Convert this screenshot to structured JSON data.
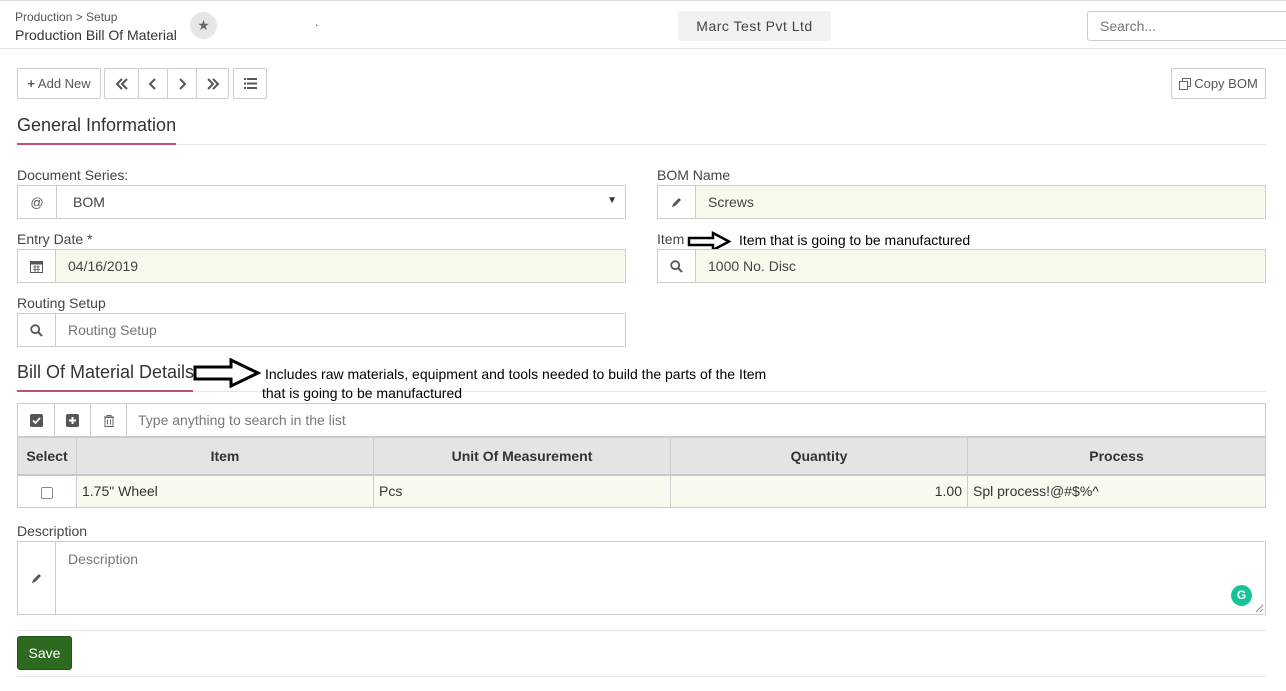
{
  "header": {
    "breadcrumb": "Production > Setup",
    "title": "Production Bill Of Material",
    "dot": ".",
    "company": "Marc Test Pvt Ltd",
    "search_placeholder": "Search..."
  },
  "toolbar": {
    "add_new_label": "Add New",
    "copy_bom_label": "Copy BOM"
  },
  "general": {
    "title": "General Information",
    "document_series_label": "Document Series:",
    "document_series_value": "BOM",
    "bom_name_label": "BOM Name",
    "bom_name_value": "Screws",
    "entry_date_label": "Entry Date *",
    "entry_date_value": "04/16/2019",
    "item_label": "Item",
    "item_value": "1000 No. Disc",
    "item_annotation": "Item that is going to be manufactured",
    "routing_label": "Routing Setup",
    "routing_placeholder": "Routing Setup"
  },
  "details": {
    "title": "Bill Of Material Details",
    "annotation_line1": "Includes raw materials, equipment and tools needed to build the parts of the Item",
    "annotation_line2": "that is going to be manufactured",
    "search_placeholder": "Type anything to search in the list",
    "columns": [
      "Select",
      "Item",
      "Unit Of Measurement",
      "Quantity",
      "Process"
    ],
    "rows": [
      {
        "item": "1.75\" Wheel",
        "uom": "Pcs",
        "quantity": "1.00",
        "process": "Spl process!@#$%^"
      }
    ]
  },
  "description": {
    "label": "Description",
    "placeholder": "Description"
  },
  "actions": {
    "save_label": "Save"
  },
  "colors": {
    "accent_underline": "#c0506e",
    "highlight_field": "#f6fbec",
    "save_button": "#2d6a1f",
    "grammarly": "#15c39a"
  }
}
